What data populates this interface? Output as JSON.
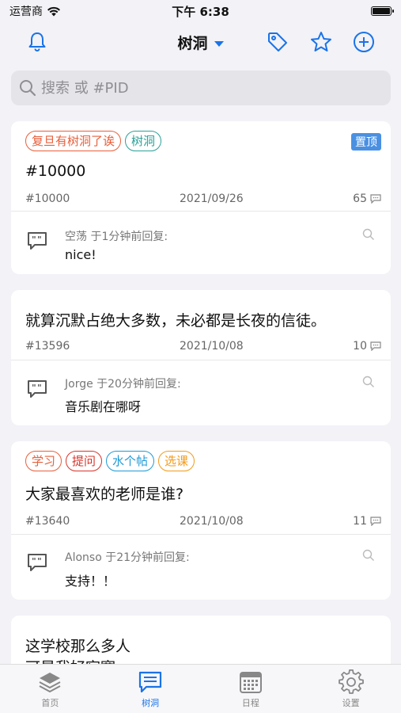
{
  "status_bar": {
    "carrier": "运营商",
    "time": "下午 6:38"
  },
  "nav": {
    "title": "树洞",
    "icons": [
      "bell-icon",
      "tag-icon",
      "star-icon",
      "plus-circle-icon"
    ]
  },
  "search": {
    "placeholder": "搜索 或 #PID"
  },
  "posts": [
    {
      "tags": [
        {
          "label": "复旦有树洞了诶",
          "color": "#e8603c"
        },
        {
          "label": "树洞",
          "color": "#2aa198"
        }
      ],
      "pinned_label": "置顶",
      "text": "#10000",
      "pid": "#10000",
      "date": "2021/09/26",
      "reply_count": "65",
      "reply": {
        "who": "空荡 于1分钟前回复:",
        "text": "nice!"
      }
    },
    {
      "tags": [],
      "text": "就算沉默占绝大多数，未必都是长夜的信徒。",
      "pid": "#13596",
      "date": "2021/10/08",
      "reply_count": "10",
      "reply": {
        "who": "Jorge 于20分钟前回复:",
        "text": "音乐剧在哪呀"
      }
    },
    {
      "tags": [
        {
          "label": "学习",
          "color": "#e8603c"
        },
        {
          "label": "提问",
          "color": "#d9342b"
        },
        {
          "label": "水个帖",
          "color": "#1e9ad6"
        },
        {
          "label": "选课",
          "color": "#f29b1a"
        }
      ],
      "text": "大家最喜欢的老师是谁?",
      "pid": "#13640",
      "date": "2021/10/08",
      "reply_count": "11",
      "reply": {
        "who": "Alonso 于21分钟前回复:",
        "text": "支持！！"
      }
    },
    {
      "tags": [],
      "text_lines": [
        "这学校那么多人",
        "可是我好寂寞"
      ]
    }
  ],
  "tabbar": [
    {
      "label": "首页",
      "icon": "layers-icon",
      "active": false
    },
    {
      "label": "树洞",
      "icon": "chat-bubble-icon",
      "active": true
    },
    {
      "label": "日程",
      "icon": "calendar-icon",
      "active": false
    },
    {
      "label": "设置",
      "icon": "gear-icon",
      "active": false
    }
  ],
  "colors": {
    "accent": "#1a73e8",
    "pin": "#4a90e2"
  }
}
